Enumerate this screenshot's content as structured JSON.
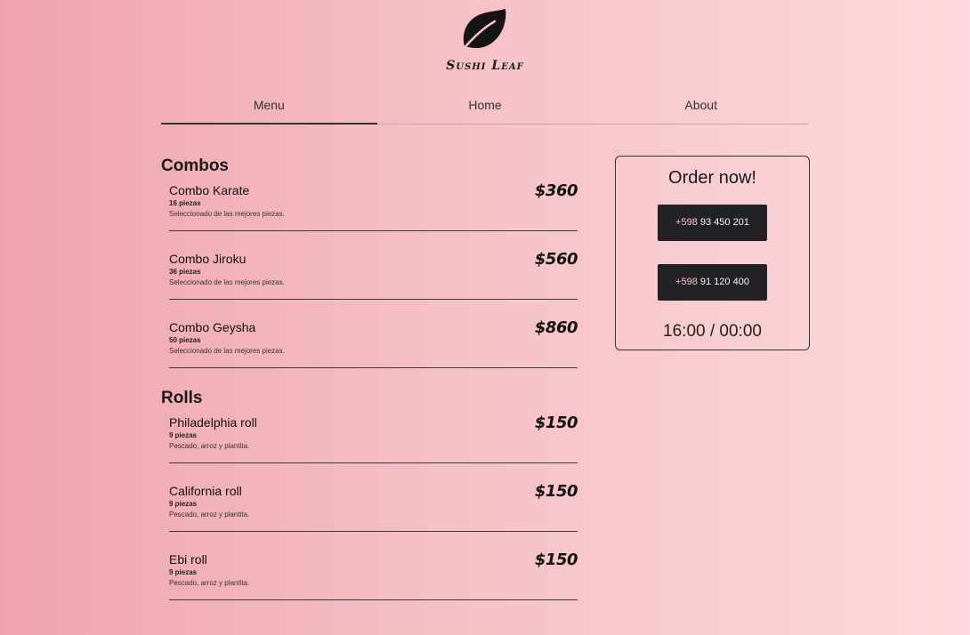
{
  "brand": {
    "name": "Sushi Leaf",
    "icon": "leaf-icon"
  },
  "nav": {
    "items": [
      {
        "label": "Menu",
        "active": true
      },
      {
        "label": "Home"
      },
      {
        "label": "About"
      }
    ]
  },
  "sections": [
    {
      "title": "Combos",
      "items": [
        {
          "name": "Combo Karate",
          "count": "16 piezas",
          "desc": "Seleccionado de las mejores piezas.",
          "price": "$360"
        },
        {
          "name": "Combo Jiroku",
          "count": "36 piezas",
          "desc": "Seleccionado de las mejores piezas.",
          "price": "$560"
        },
        {
          "name": "Combo Geysha",
          "count": "50 piezas",
          "desc": "Seleccionado de las mejores piezas.",
          "price": "$860"
        }
      ]
    },
    {
      "title": "Rolls",
      "items": [
        {
          "name": "Philadelphia roll",
          "count": "9 piezas",
          "desc": "Pescado, arroz y plantita.",
          "price": "$150"
        },
        {
          "name": "California roll",
          "count": "9 piezas",
          "desc": "Pescado, arroz y plantita.",
          "price": "$150"
        },
        {
          "name": "Ebi roll",
          "count": "9 piezas",
          "desc": "Pescado, arroz y plantita.",
          "price": "$150"
        }
      ]
    }
  ],
  "order": {
    "title": "Order now!",
    "phones": [
      {
        "prefix": "+598",
        "number": "93 450 201"
      },
      {
        "prefix": "+598",
        "number": "91 120 400"
      }
    ],
    "hours": "16:00 / 00:00"
  },
  "colors": {
    "bg_start": "#f0a3ad",
    "bg_end": "#fcd9de",
    "button": "#222226",
    "prefix": "#f2c6cc"
  }
}
